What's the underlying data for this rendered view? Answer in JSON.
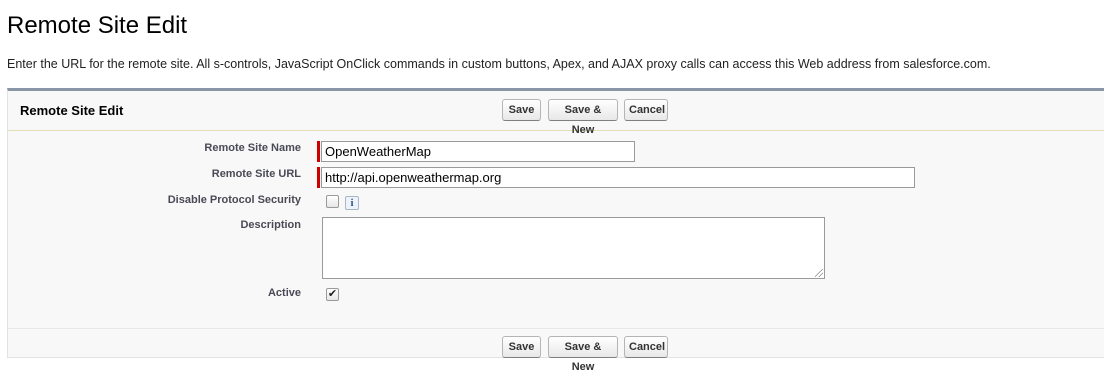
{
  "page": {
    "title": "Remote Site Edit",
    "description": "Enter the URL for the remote site. All s-controls, JavaScript OnClick commands in custom buttons, Apex, and AJAX proxy calls can access this Web address from salesforce.com."
  },
  "panel": {
    "title": "Remote Site Edit",
    "buttons": {
      "save": "Save",
      "save_new": "Save & New",
      "cancel": "Cancel"
    }
  },
  "form": {
    "remote_site_name": {
      "label": "Remote Site Name",
      "value": "OpenWeatherMap",
      "required": true
    },
    "remote_site_url": {
      "label": "Remote Site URL",
      "value": "http://api.openweathermap.org",
      "required": true
    },
    "disable_protocol_security": {
      "label": "Disable Protocol Security",
      "checked": false,
      "info_icon": "info-icon",
      "info_glyph": "i"
    },
    "description": {
      "label": "Description",
      "value": ""
    },
    "active": {
      "label": "Active",
      "checked": true,
      "check_glyph": "✔"
    }
  },
  "colors": {
    "panel_border": "#8a95a6",
    "required_marker": "#cc0000",
    "label_text": "#4a4a56"
  }
}
